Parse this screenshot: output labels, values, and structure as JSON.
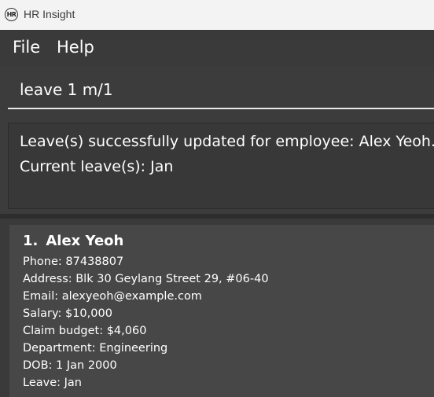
{
  "window": {
    "icon_text": "HR",
    "title": "HR Insight"
  },
  "menu": {
    "items": [
      {
        "label": "File"
      },
      {
        "label": "Help"
      }
    ]
  },
  "command": {
    "value": "leave 1 m/1"
  },
  "result": {
    "lines": [
      "Leave(s) successfully updated for employee: Alex Yeoh.",
      "Current leave(s): Jan"
    ]
  },
  "persons": [
    {
      "index": "1.",
      "name": "Alex Yeoh",
      "fields": [
        "Phone: 87438807",
        "Address: Blk 30 Geylang Street 29, #06-40",
        "Email: alexyeoh@example.com",
        "Salary: $10,000",
        "Claim budget: $4,060",
        "Department: Engineering",
        "DOB: 1 Jan 2000",
        "Leave: Jan"
      ]
    }
  ]
}
